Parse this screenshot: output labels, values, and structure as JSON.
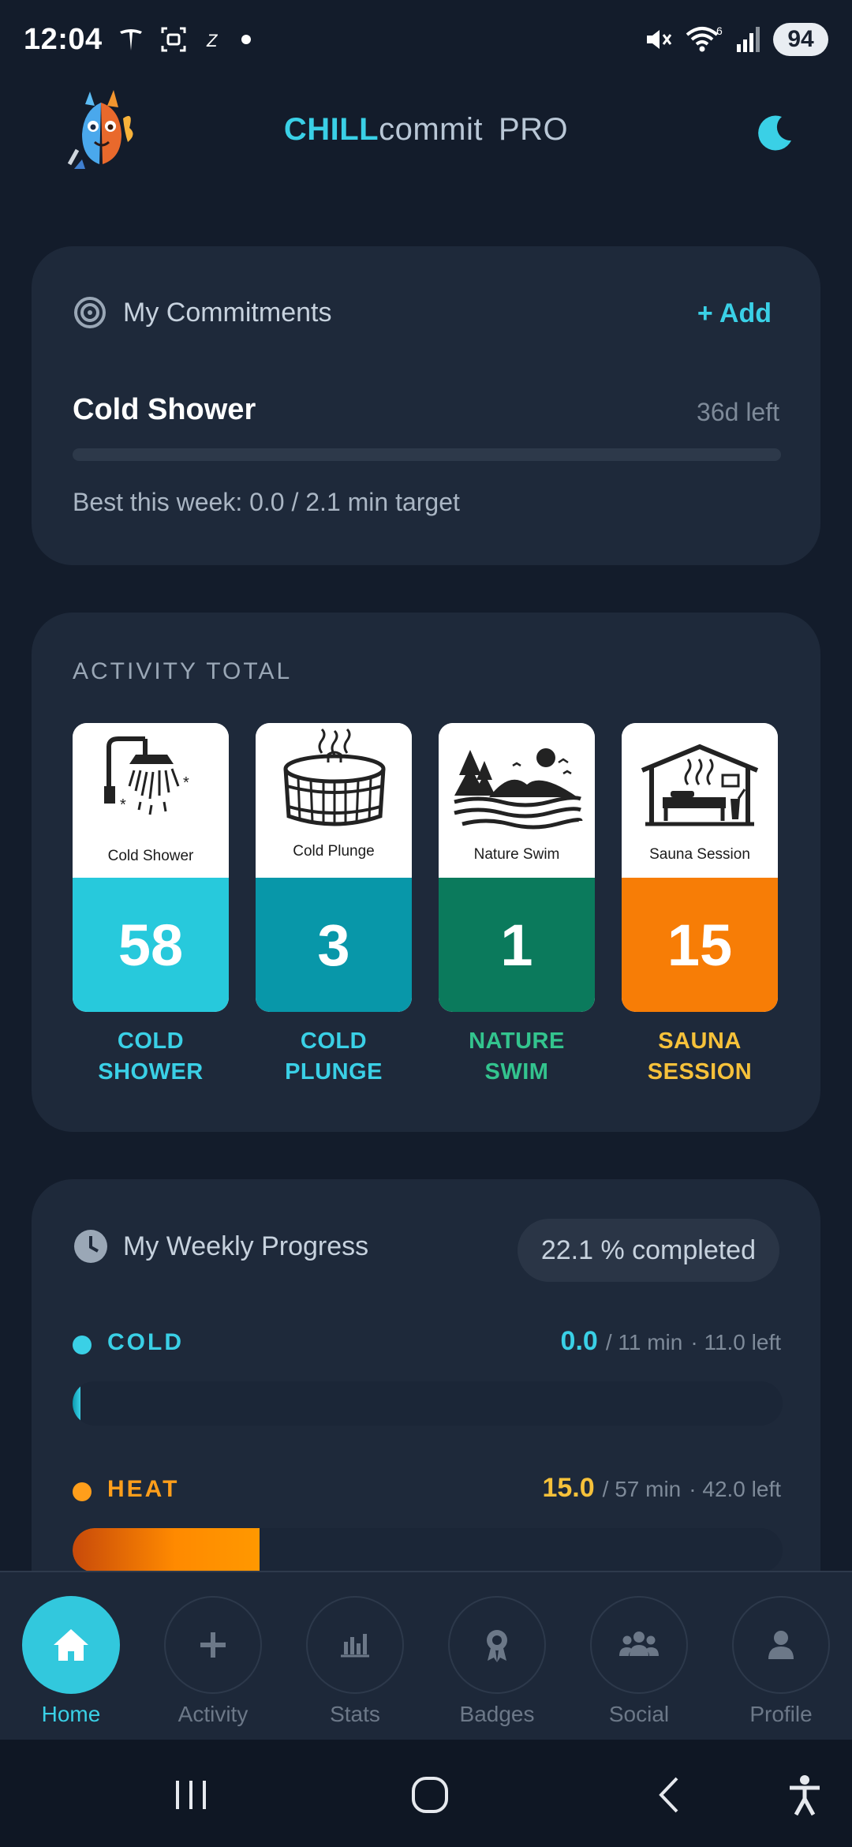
{
  "status_bar": {
    "time": "12:04",
    "wifi_label": "6",
    "battery": "94"
  },
  "header": {
    "brand_part1": "CHILL",
    "brand_part2": "commit",
    "brand_part3": "PRO",
    "mascot_icon": "fire-ice-mascot-icon",
    "theme_icon": "moon-icon"
  },
  "commitments": {
    "title": "My Commitments",
    "add_label": "+ Add",
    "item_name": "Cold Shower",
    "days_left": "36d left",
    "progress_fraction": 0.0,
    "best_text": "Best this week: 0.0 / 2.1 min target"
  },
  "activity_total": {
    "section_label": "ACTIVITY TOTAL",
    "tiles": [
      {
        "caption": "Cold Shower",
        "count": "58",
        "label_line1": "COLD",
        "label_line2": "SHOWER",
        "tile_color": "#27c9dc",
        "label_color": "#3ad0e6"
      },
      {
        "caption": "Cold Plunge",
        "count": "3",
        "label_line1": "COLD",
        "label_line2": "PLUNGE",
        "tile_color": "#0897a9",
        "label_color": "#3ad0e6"
      },
      {
        "caption": "Nature Swim",
        "count": "1",
        "label_line1": "NATURE",
        "label_line2": "SWIM",
        "tile_color": "#0b7a5c",
        "label_color": "#33c48e"
      },
      {
        "caption": "Sauna Session",
        "count": "15",
        "label_line1": "SAUNA",
        "label_line2": "SESSION",
        "tile_color": "#f77d06",
        "label_color": "#f6c13a"
      }
    ]
  },
  "weekly_progress": {
    "title": "My Weekly Progress",
    "completed": "22.1 % completed",
    "cold": {
      "name": "COLD",
      "value": "0.0",
      "target": "/ 11 min",
      "left": "· 11.0 left",
      "fraction": 0.0,
      "color": "#3ad0e6"
    },
    "heat": {
      "name": "HEAT",
      "value": "15.0",
      "target": "/ 57 min",
      "left": "· 42.0 left",
      "fraction": 0.263,
      "color": "#ff9e1b",
      "value_color": "#f6c13a"
    }
  },
  "bottom_nav": {
    "items": [
      {
        "label": "Home",
        "icon": "home-icon",
        "active": true
      },
      {
        "label": "Activity",
        "icon": "plus-icon",
        "active": false
      },
      {
        "label": "Stats",
        "icon": "bar-chart-icon",
        "active": false
      },
      {
        "label": "Badges",
        "icon": "badge-icon",
        "active": false
      },
      {
        "label": "Social",
        "icon": "group-icon",
        "active": false
      },
      {
        "label": "Profile",
        "icon": "user-icon",
        "active": false
      }
    ]
  }
}
